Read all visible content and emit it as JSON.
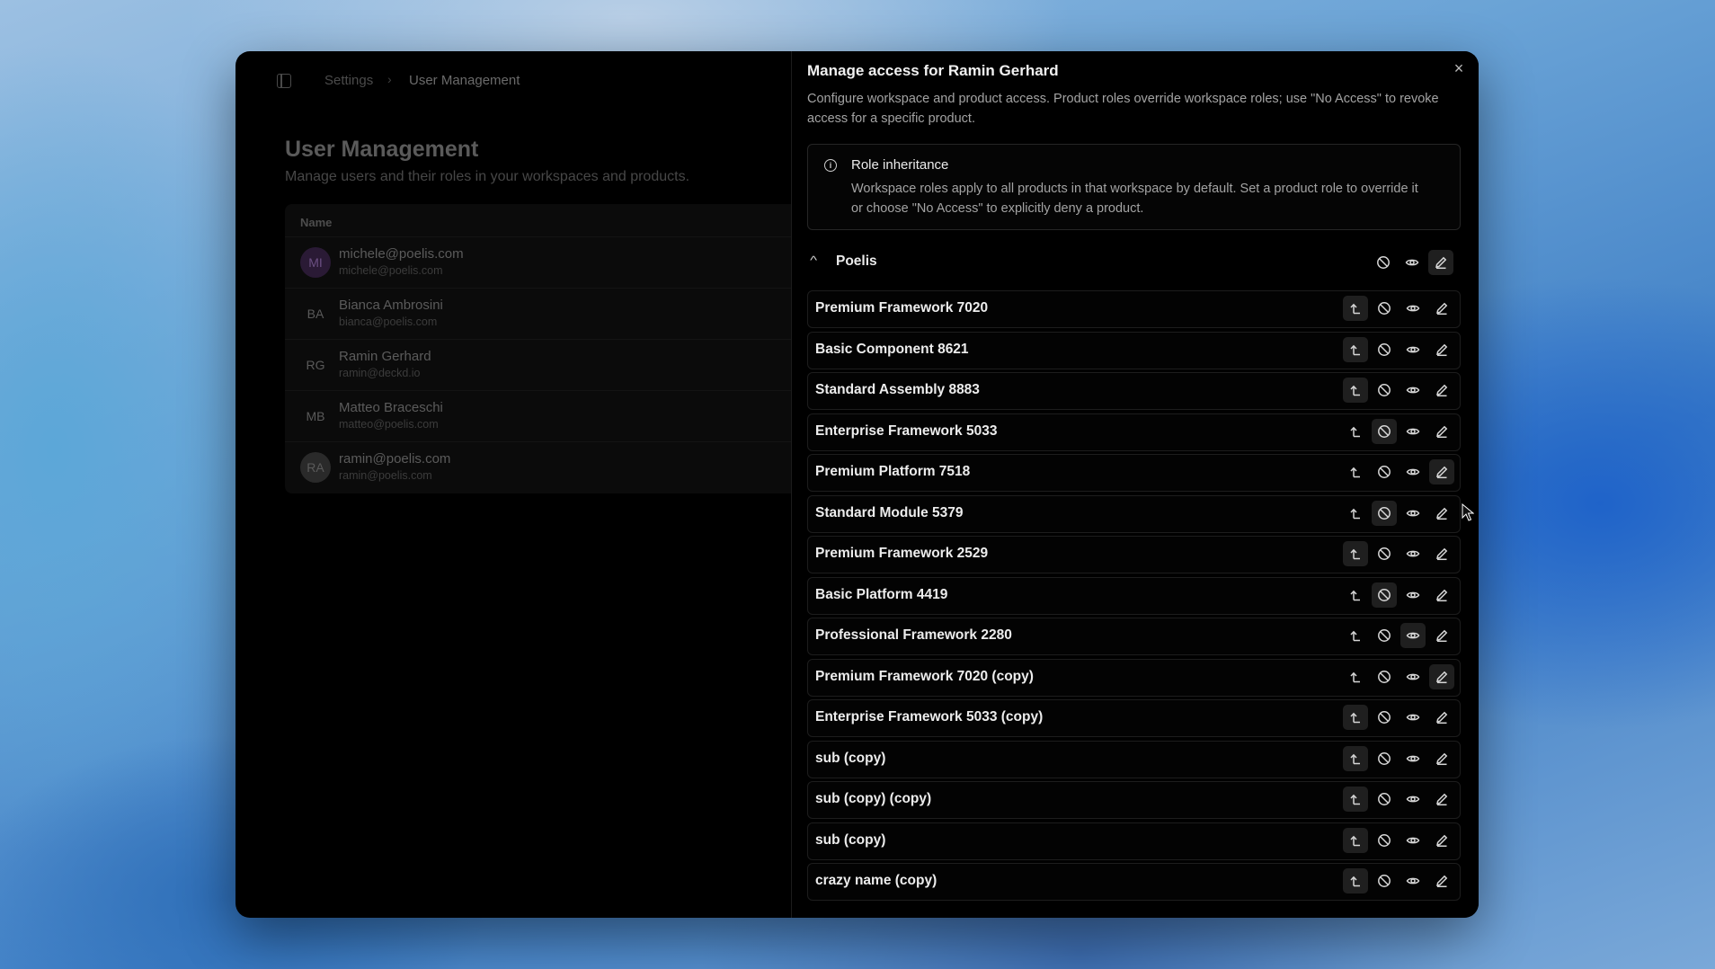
{
  "breadcrumb": {
    "root": "Settings",
    "current": "User Management"
  },
  "page": {
    "title": "User Management",
    "subtitle": "Manage users and their roles in your workspaces and products."
  },
  "users_table": {
    "column": "Name",
    "rows": [
      {
        "initials": "MI",
        "name": "michele@poelis.com",
        "email": "michele@poelis.com"
      },
      {
        "initials": "BA",
        "name": "Bianca Ambrosini",
        "email": "bianca@poelis.com"
      },
      {
        "initials": "RG",
        "name": "Ramin Gerhard",
        "email": "ramin@deckd.io"
      },
      {
        "initials": "MB",
        "name": "Matteo Braceschi",
        "email": "matteo@poelis.com"
      },
      {
        "initials": "RA",
        "name": "ramin@poelis.com",
        "email": "ramin@poelis.com"
      }
    ]
  },
  "panel": {
    "title": "Manage access for Ramin Gerhard",
    "description": "Configure workspace and product access. Product roles override workspace roles; use \"No Access\" to revoke access for a specific product.",
    "info": {
      "title": "Role inheritance",
      "text": "Workspace roles apply to all products in that workspace by default. Set a product role to override it or choose \"No Access\" to explicitly deny a product."
    },
    "workspace": {
      "name": "Poelis"
    },
    "products": [
      "Premium Framework 7020",
      "Basic Component 8621",
      "Standard Assembly 8883",
      "Enterprise Framework 5033",
      "Premium Platform 7518",
      "Standard Module 5379",
      "Premium Framework 2529",
      "Basic Platform 4419",
      "Professional Framework 2280",
      "Premium Framework 7020 (copy)",
      "Enterprise Framework 5033 (copy)",
      "sub (copy)",
      "sub (copy) (copy)",
      "sub (copy)",
      "crazy name (copy)"
    ],
    "close_label": "×"
  },
  "icons": {
    "reset": "inherit-reset-icon",
    "block": "no-access-icon",
    "view": "eye-icon",
    "edit": "pencil-icon",
    "info": "info-icon",
    "chevron": "chevron-up-icon",
    "sidebar": "sidebar-toggle-icon"
  }
}
